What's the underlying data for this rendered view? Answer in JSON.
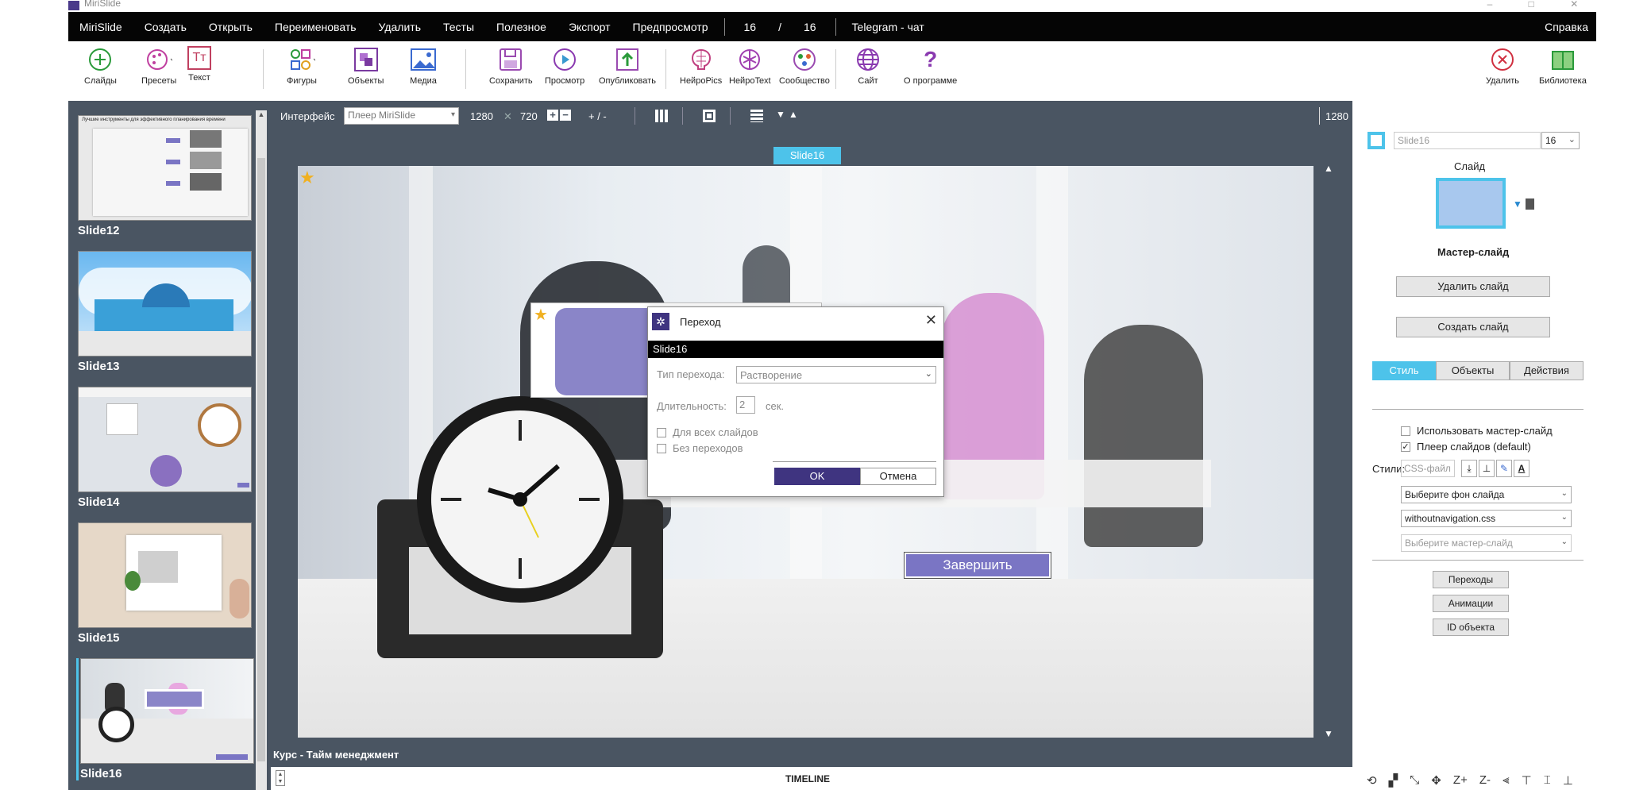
{
  "window": {
    "title": "MiriSlide"
  },
  "menu": {
    "items": [
      "MiriSlide",
      "Создать",
      "Открыть",
      "Переименовать",
      "Удалить",
      "Тесты",
      "Полезное",
      "Экспорт",
      "Предпросмотр"
    ],
    "current_slide": "16",
    "slash": "/",
    "total_slides": "16",
    "telegram": "Telegram - чат",
    "help": "Справка"
  },
  "toolbar": {
    "slides": "Слайды",
    "presets": "Пресеты",
    "text": "Текст",
    "shapes": "Фигуры",
    "objects": "Объекты",
    "media": "Медиа",
    "save": "Сохранить",
    "preview": "Просмотр",
    "publish": "Опубликовать",
    "neuropics": "НейроPics",
    "neurotext": "НейроText",
    "community": "Сообщество",
    "site": "Сайт",
    "about": "О программе",
    "delete": "Удалить",
    "library": "Библиотека",
    "text_icon_glyph": "Тт",
    "about_icon_glyph": "?"
  },
  "slides_panel": {
    "items": [
      {
        "label": "Slide12",
        "thumb_title": "Лучшие инструменты для эффективного планирования времени"
      },
      {
        "label": "Slide13"
      },
      {
        "label": "Slide14"
      },
      {
        "label": "Slide15"
      },
      {
        "label": "Slide16"
      }
    ],
    "selected": "Slide16"
  },
  "canvas_toolbar": {
    "interface_label": "Интерфейс",
    "player_select": "Плеер MiriSlide",
    "width": "1280",
    "times": "✕",
    "height": "720",
    "zoom": "+ / -",
    "ruler_value": "1280"
  },
  "slide": {
    "tab": "Slide16",
    "finish_button": "Завершить"
  },
  "course": {
    "label": "Курс -",
    "name": "Тайм менеджмент"
  },
  "timeline": {
    "label": "TIMELINE"
  },
  "dialog": {
    "title": "Переход",
    "slide_name": "Slide16",
    "type_label": "Тип перехода:",
    "type_value": "Растворение",
    "duration_label": "Длительность:",
    "duration_value": "2",
    "duration_unit": "сек.",
    "all_slides": "Для всех слайдов",
    "no_transitions": "Без переходов",
    "ok": "OK",
    "cancel": "Отмена"
  },
  "right_panel": {
    "slide_name": "Slide16",
    "slide_number": "16",
    "slide_label": "Слайд",
    "master_label": "Мастер-слайд",
    "delete_slide": "Удалить слайд",
    "create_slide": "Создать слайд",
    "tabs": [
      "Стиль",
      "Объекты",
      "Действия"
    ],
    "active_tab": "Стиль",
    "use_master": "Использовать мастер-слайд",
    "player_default": "Плеер слайдов (default)",
    "styles_label": "Стили:",
    "css_placeholder": "CSS-файл",
    "bg_select": "Выберите фон слайда",
    "css_select": "withoutnavigation.css",
    "master_select": "Выберите мастер-слайд",
    "transitions": "Переходы",
    "animations": "Анимации",
    "object_id": "ID объекта",
    "slide_color": "#a8c8ee"
  },
  "colors": {
    "accent": "#4dc3ea",
    "dark": "#4a5562",
    "purple": "#7a75c4",
    "dialog_ok": "#3f3480"
  }
}
